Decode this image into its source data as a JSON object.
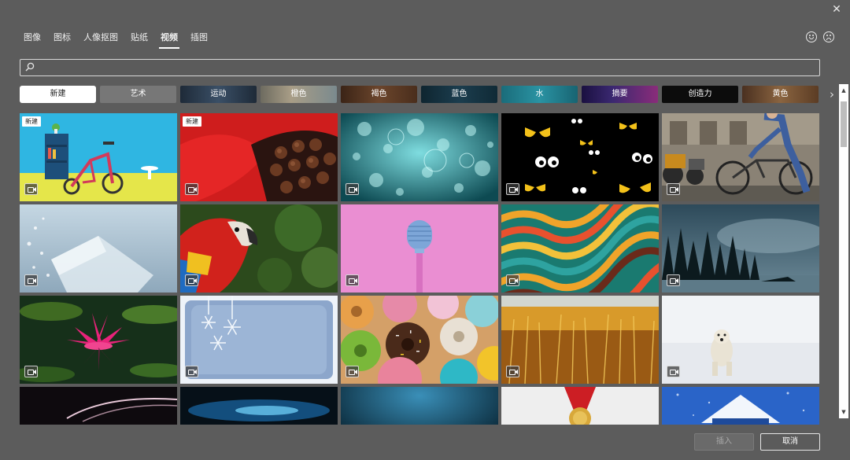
{
  "dialog": {
    "close_label": "✕",
    "tabs": [
      {
        "label": "图像",
        "active": false
      },
      {
        "label": "图标",
        "active": false
      },
      {
        "label": "人像抠图",
        "active": false
      },
      {
        "label": "贴纸",
        "active": false
      },
      {
        "label": "视频",
        "active": true
      },
      {
        "label": "插图",
        "active": false
      }
    ],
    "search": {
      "value": "",
      "placeholder": ""
    },
    "categories": [
      {
        "label": "新建",
        "color": "#ffffff"
      },
      {
        "label": "艺术",
        "color": "#777777"
      },
      {
        "label": "运动",
        "color": "#2d3748"
      },
      {
        "label": "橙色",
        "color": "#8c7a5a"
      },
      {
        "label": "褐色",
        "color": "#5a3a26"
      },
      {
        "label": "蓝色",
        "color": "#15303e"
      },
      {
        "label": "水",
        "color": "#1f7a86"
      },
      {
        "label": "摘要",
        "color": "#2a1c4a"
      },
      {
        "label": "创造力",
        "color": "#0c0c0c"
      },
      {
        "label": "黄色",
        "color": "#6b4a2e"
      }
    ],
    "thumbnails": [
      {
        "name": "tricycle",
        "badge": "新建"
      },
      {
        "name": "chocolates",
        "badge": "新建"
      },
      {
        "name": "bubbles-teal",
        "badge": ""
      },
      {
        "name": "cartoon-eyes",
        "badge": ""
      },
      {
        "name": "cyclist",
        "badge": ""
      },
      {
        "name": "ice-water",
        "badge": ""
      },
      {
        "name": "parrot",
        "badge": ""
      },
      {
        "name": "microphone",
        "badge": ""
      },
      {
        "name": "color-waves",
        "badge": ""
      },
      {
        "name": "misty-forest",
        "badge": ""
      },
      {
        "name": "water-lily",
        "badge": ""
      },
      {
        "name": "snowflakes-frame",
        "badge": ""
      },
      {
        "name": "donuts",
        "badge": ""
      },
      {
        "name": "wheat-field",
        "badge": ""
      },
      {
        "name": "polar-bear",
        "badge": ""
      },
      {
        "name": "dark-lines",
        "badge": ""
      },
      {
        "name": "blue-glow",
        "badge": ""
      },
      {
        "name": "deep-blue",
        "badge": ""
      },
      {
        "name": "medal",
        "badge": ""
      },
      {
        "name": "snow-house",
        "badge": ""
      }
    ],
    "buttons": {
      "insert": "插入",
      "cancel": "取消"
    },
    "scroll": {
      "up": "▲",
      "down": "▼"
    },
    "chip_next": "›"
  }
}
